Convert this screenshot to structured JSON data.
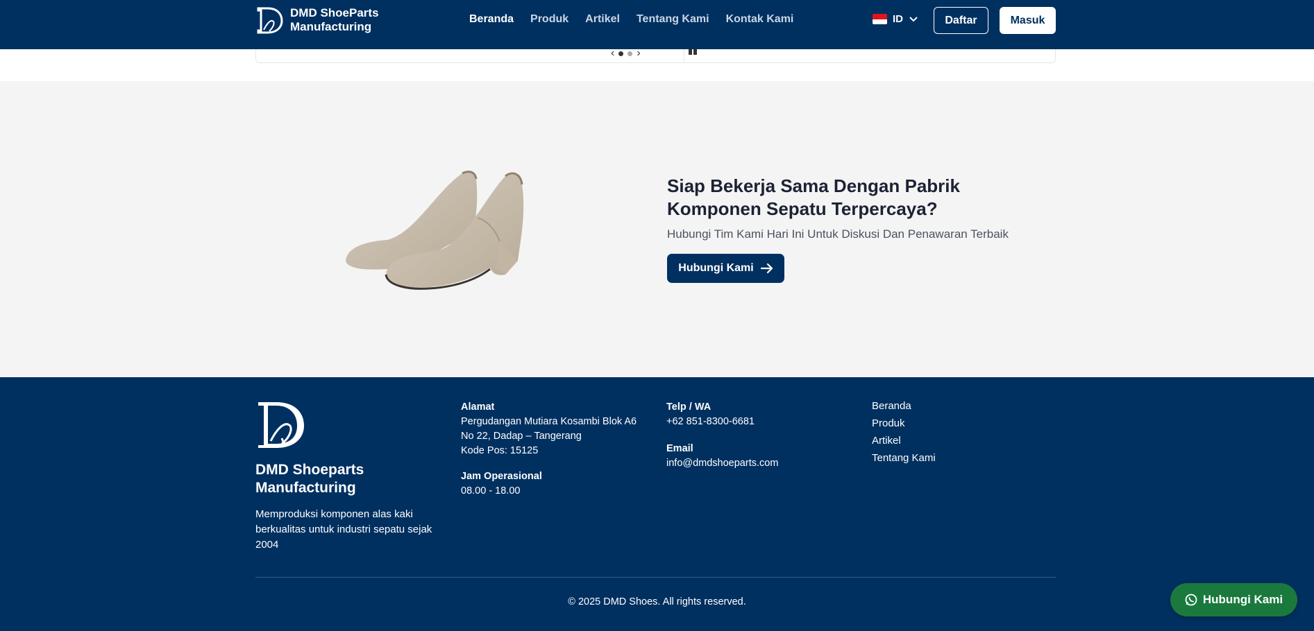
{
  "header": {
    "brand_line1": "DMD ShoeParts",
    "brand_line2": "Manufacturing",
    "nav": [
      "Beranda",
      "Produk",
      "Artikel",
      "Tentang Kami",
      "Kontak Kami"
    ],
    "active_nav": "Beranda",
    "language": "ID",
    "register_label": "Daftar",
    "login_label": "Masuk"
  },
  "cta": {
    "title": "Siap Bekerja Sama Dengan Pabrik Komponen Sepatu Terpercaya?",
    "subtitle": "Hubungi Tim Kami Hari Ini Untuk Diskusi Dan Penawaran Terbaik",
    "button_label": "Hubungi Kami"
  },
  "footer": {
    "brand_line1": "DMD Shoeparts",
    "brand_line2": "Manufacturing",
    "description": "Memproduksi komponen alas kaki berkualitas untuk industri sepatu sejak 2004",
    "address_heading": "Alamat",
    "address_line1": "Pergudangan Mutiara Kosambi Blok A6",
    "address_line2": "No 22, Dadap – Tangerang",
    "address_line3": "Kode Pos: 15125",
    "hours_heading": "Jam Operasional",
    "hours_value": "08.00 - 18.00",
    "phone_heading": "Telp / WA",
    "phone_value": "+62 851-8300-6681",
    "email_heading": "Email",
    "email_value": "info@dmdshoeparts.com",
    "links": [
      "Beranda",
      "Produk",
      "Artikel",
      "Tentang Kami"
    ],
    "copyright": "© 2025 DMD Shoes. All rights reserved."
  },
  "whatsapp": {
    "label": "Hubungi Kami"
  },
  "colors": {
    "primary": "#003060",
    "whatsapp": "#1a7a3e",
    "section_bg": "#f4f4f4"
  }
}
